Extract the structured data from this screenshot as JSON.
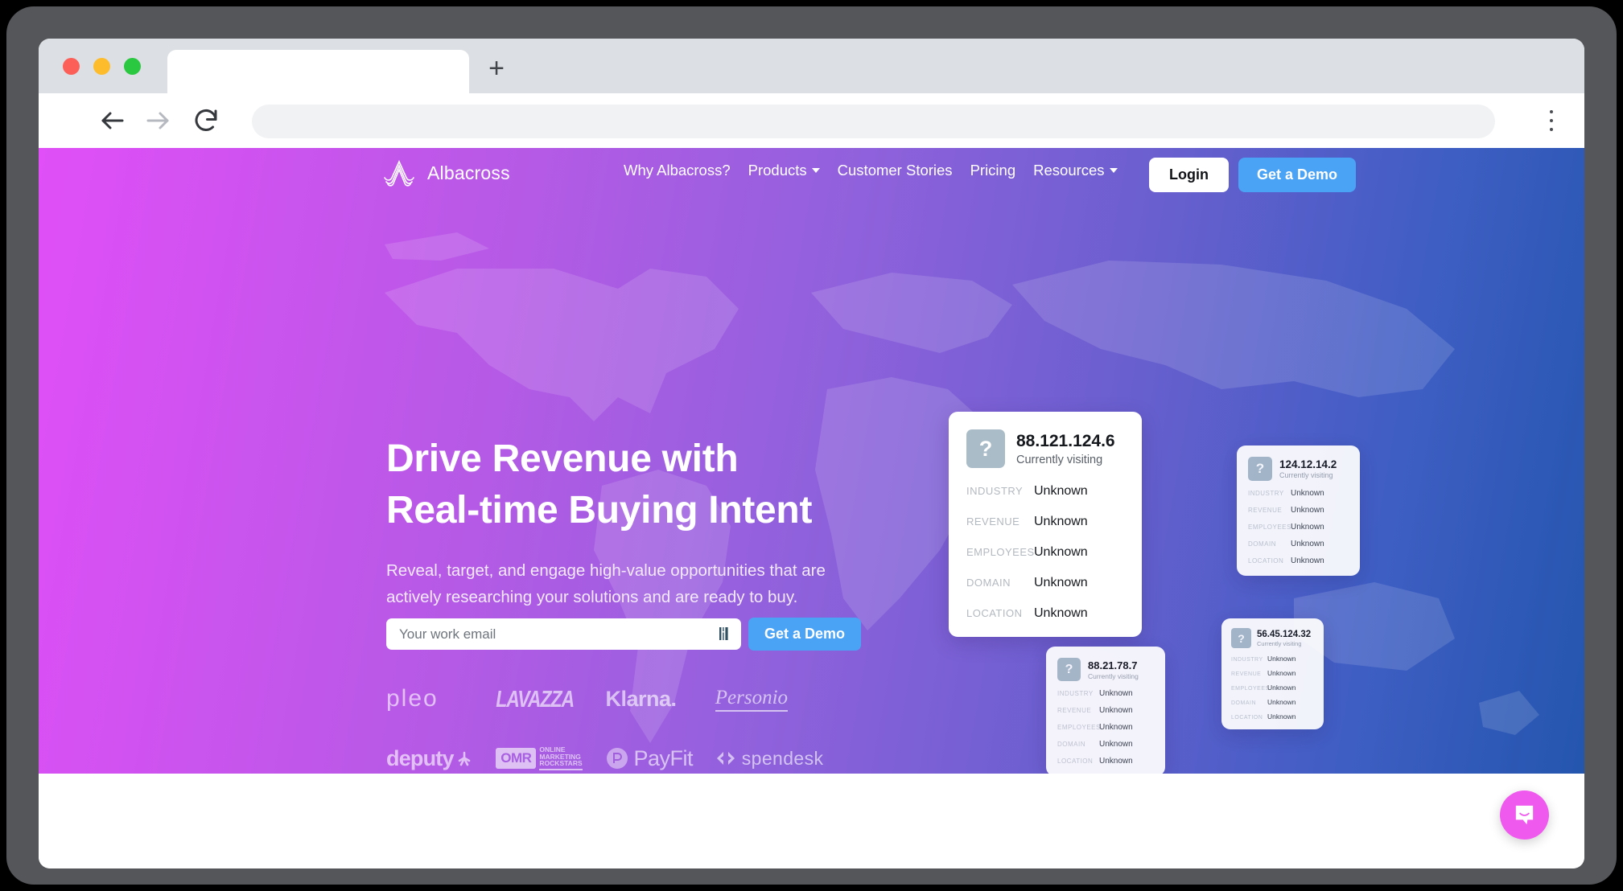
{
  "browser": {
    "tab_title": "",
    "new_tab_label": "+",
    "url_value": "",
    "url_placeholder": "",
    "controls": {
      "back": "back-arrow",
      "forward": "forward-arrow",
      "reload": "reload-arrow",
      "menu": "kebab-menu"
    },
    "traffic_lights": {
      "close_color": "#fc5f57",
      "minimize_color": "#fdbc2c",
      "maximize_color": "#2ac840"
    }
  },
  "site": {
    "brand": {
      "name": "Albacross",
      "mark": "wave-peak-logo"
    },
    "nav_links": [
      {
        "label": "Why Albacross?",
        "has_caret": false
      },
      {
        "label": "Products",
        "has_caret": true
      },
      {
        "label": "Customer Stories",
        "has_caret": false
      },
      {
        "label": "Pricing",
        "has_caret": false
      },
      {
        "label": "Resources",
        "has_caret": true
      }
    ],
    "actions": {
      "login_label": "Login",
      "demo_label": "Get a Demo"
    }
  },
  "hero": {
    "headline_line1": "Drive Revenue with",
    "headline_line2": "Real-time Buying Intent",
    "subtitle": "Reveal, target, and engage high-value opportunities that are actively researching your solutions and are ready to buy.",
    "form": {
      "email_value": "",
      "email_placeholder": "Your work email",
      "submit_label": "Get a Demo"
    },
    "gradient": {
      "from": "#e04ff7",
      "mid": "#9061dc",
      "to": "#2456ae"
    },
    "accent_blue": "#4aa3f5"
  },
  "customer_logos": [
    {
      "name": "pleo",
      "text": "pleo"
    },
    {
      "name": "lavazza",
      "text": "LAVAZZA"
    },
    {
      "name": "klarna",
      "text": "Klarna."
    },
    {
      "name": "personio",
      "text": "Personio"
    },
    {
      "name": "deputy",
      "text": "deputy"
    },
    {
      "name": "omr",
      "text": "OMR",
      "sub1": "ONLINE",
      "sub2": "MARKETING",
      "sub3": "ROCKSTARS"
    },
    {
      "name": "payfit",
      "text": "PayFit"
    },
    {
      "name": "spendesk",
      "text": "spendesk"
    }
  ],
  "visitor_cards": {
    "field_labels": {
      "industry": "INDUSTRY",
      "revenue": "REVENUE",
      "employees": "EMPLOYEES",
      "domain": "DOMAIN",
      "location": "LOCATION"
    },
    "status_text": "Currently visiting",
    "avatar_glyph": "?",
    "avatar_color": "#a9bcc8",
    "main": {
      "ip": "88.121.124.6",
      "status": "Currently visiting",
      "industry": "Unknown",
      "revenue": "Unknown",
      "employees": "Unknown",
      "domain": "Unknown",
      "location": "Unknown"
    },
    "top_right": {
      "ip": "124.12.14.2",
      "status": "Currently visiting",
      "industry": "Unknown",
      "revenue": "Unknown",
      "employees": "Unknown",
      "domain": "Unknown",
      "location": "Unknown"
    },
    "bottom_middle": {
      "ip": "88.21.78.7",
      "status": "Currently visiting",
      "industry": "Unknown",
      "revenue": "Unknown",
      "employees": "Unknown",
      "domain": "Unknown",
      "location": "Unknown"
    },
    "bottom_right": {
      "ip": "56.45.124.32",
      "status": "Currently visiting",
      "industry": "Unknown",
      "revenue": "Unknown",
      "employees": "Unknown",
      "domain": "Unknown",
      "location": "Unknown"
    }
  },
  "chat_widget": {
    "name": "intercom-launcher",
    "color": "#f059ee"
  }
}
